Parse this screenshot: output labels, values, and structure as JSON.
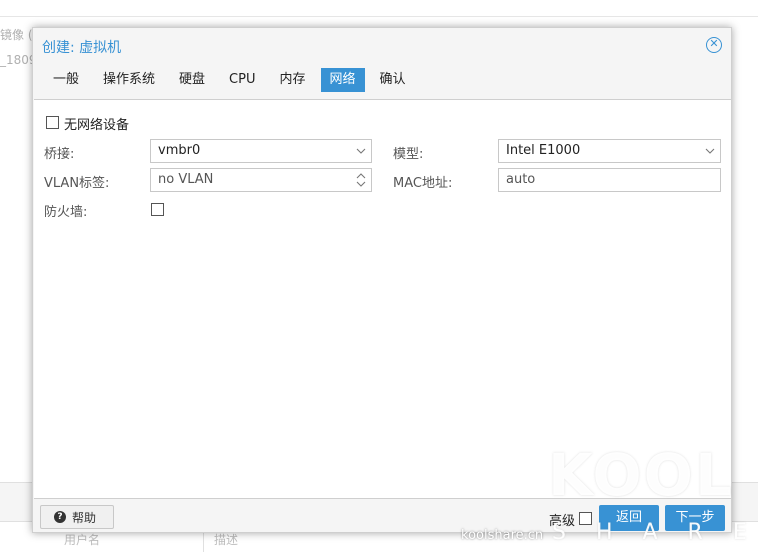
{
  "background": {
    "side_texts": [
      "镜像 (",
      "_1809"
    ],
    "table_headers": [
      "用户名",
      "描述"
    ]
  },
  "dialog": {
    "title": "创建: 虚拟机",
    "close_icon": "close-circle-icon",
    "tabs": [
      {
        "label": "一般",
        "active": false
      },
      {
        "label": "操作系统",
        "active": false
      },
      {
        "label": "硬盘",
        "active": false
      },
      {
        "label": "CPU",
        "active": false
      },
      {
        "label": "内存",
        "active": false
      },
      {
        "label": "网络",
        "active": true
      },
      {
        "label": "确认",
        "active": false
      }
    ],
    "form": {
      "no_network_label": "无网络设备",
      "no_network_checked": false,
      "bridge_label": "桥接:",
      "bridge_value": "vmbr0",
      "vlan_label": "VLAN标签:",
      "vlan_value": "no VLAN",
      "firewall_label": "防火墙:",
      "firewall_checked": false,
      "model_label": "模型:",
      "model_value": "Intel E1000",
      "mac_label": "MAC地址:",
      "mac_value": "auto"
    },
    "footer": {
      "help_label": "帮助",
      "help_icon": "question-circle-icon",
      "advanced_label": "高级",
      "advanced_checked": false,
      "back_label": "返回",
      "next_label": "下一步"
    }
  },
  "watermark": {
    "logo": "KOOL",
    "subtitle": "SHARE",
    "site": "koolshare.cn"
  },
  "colors": {
    "accent": "#3892d4",
    "panel_bg": "#f5f5f5",
    "border": "#c8c8c8"
  }
}
